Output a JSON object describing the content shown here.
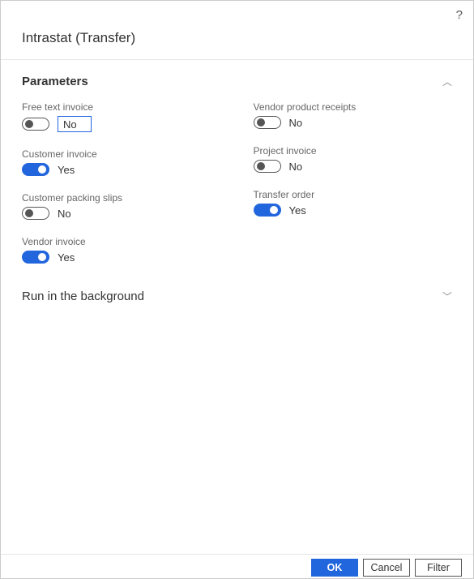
{
  "help": "?",
  "title": "Intrastat (Transfer)",
  "sections": {
    "params": {
      "title": "Parameters"
    },
    "bg": {
      "title": "Run in the background"
    }
  },
  "fields": {
    "freeTextInvoice": {
      "label": "Free text invoice",
      "value": "No",
      "on": false,
      "hasInput": true
    },
    "customerInvoice": {
      "label": "Customer invoice",
      "value": "Yes",
      "on": true
    },
    "customerPackingSlips": {
      "label": "Customer packing slips",
      "value": "No",
      "on": false
    },
    "vendorInvoice": {
      "label": "Vendor invoice",
      "value": "Yes",
      "on": true
    },
    "vendorProductReceipts": {
      "label": "Vendor product receipts",
      "value": "No",
      "on": false
    },
    "projectInvoice": {
      "label": "Project invoice",
      "value": "No",
      "on": false
    },
    "transferOrder": {
      "label": "Transfer order",
      "value": "Yes",
      "on": true
    }
  },
  "buttons": {
    "ok": "OK",
    "cancel": "Cancel",
    "filter": "Filter"
  }
}
